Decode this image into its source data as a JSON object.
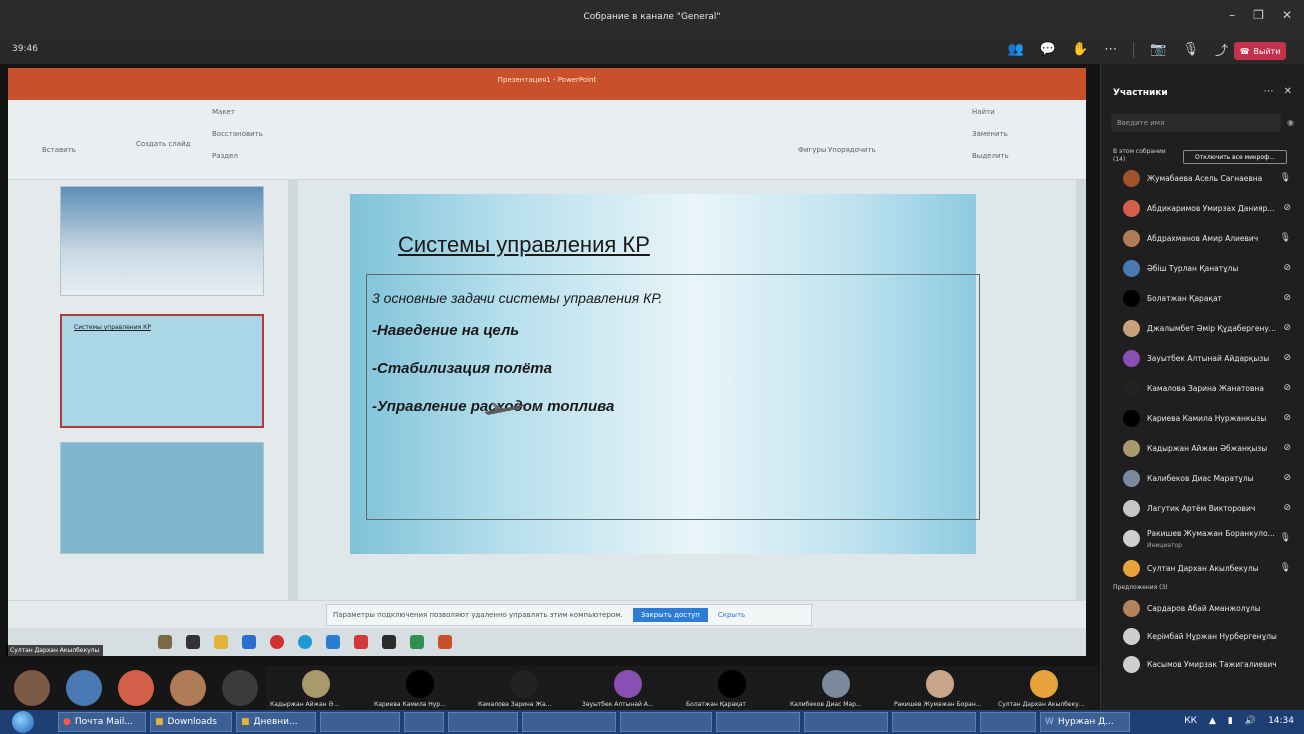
{
  "window": {
    "title": "Собрание в канале \"General\""
  },
  "meeting": {
    "timer": "39:46",
    "leave_label": "Выйти"
  },
  "shared_screen": {
    "ppt_doc_title": "Презентация1 - PowerPoint",
    "ribbon": {
      "paste": "Вставить",
      "new_slide": "Создать слайд",
      "layout": "Макет",
      "reset": "Восстановить",
      "section": "Раздел",
      "find": "Найти",
      "replace": "Заменить",
      "select": "Выделить",
      "shapes": "Фигуры",
      "arrange": "Упорядочить"
    },
    "slide": {
      "title": "Системы управления КР",
      "subtitle": "3 основные задачи системы управления КР.",
      "bullets": [
        "-Наведение на цель",
        "-Стабилизация полёта",
        "-Управление расходом топлива"
      ]
    },
    "thumb2_title": "Системы управления КР",
    "notification": {
      "text": "Параметры подключения позволяют удаленно управлять этим компьютером.",
      "button": "Закрыть доступ",
      "link": "Скрыть"
    },
    "presenter_label": "Султан Дархан Акылбекулы"
  },
  "participants_panel": {
    "title": "Участники",
    "search_placeholder": "Введите имя",
    "in_meeting_label": "В этом собрании (14)",
    "mute_all": "Отключить все микроф...",
    "participants": [
      {
        "name": "Жумабаева Асель Сагнаевна",
        "mic": "on",
        "color": "#a0522d"
      },
      {
        "name": "Абдикаримов Умирзах Данияр...",
        "mic": "off",
        "color": "#d35f4b"
      },
      {
        "name": "Абдрахманов Амир Алиевич",
        "mic": "on",
        "color": "#b07b57"
      },
      {
        "name": "Әбіш Турлан Қанатұлы",
        "mic": "off",
        "color": "#4a7ab5"
      },
      {
        "name": "Болатжан Қарақат",
        "mic": "off",
        "color": "#000000"
      },
      {
        "name": "Джалымбет Әмір Құдабергену...",
        "mic": "off",
        "color": "#c8a27a"
      },
      {
        "name": "Зауытбек Алтынай Айдарқызы",
        "mic": "off",
        "color": "#8a4fb5"
      },
      {
        "name": "Камалова Зарина Жанатовна",
        "mic": "off",
        "color": "#222222"
      },
      {
        "name": "Кариева Камила Нуржанкызы",
        "mic": "off",
        "color": "#000000"
      },
      {
        "name": "Кадыржан Айжан Әбжанқызы",
        "mic": "off",
        "color": "#a89a6c"
      },
      {
        "name": "Калибеков Диас Маратұлы",
        "mic": "off",
        "color": "#7a8a9c"
      },
      {
        "name": "Лагутик Артём Викторович",
        "mic": "off",
        "color": "#c7c7c7"
      },
      {
        "name": "Ракишев Жумажан Боранкуло...",
        "role": "Инициатор",
        "mic": "on",
        "color": "#cfcfcf"
      },
      {
        "name": "Султан Дархан Акылбекулы",
        "mic": "on",
        "color": "#e8a23a"
      }
    ],
    "suggestions_label": "Предложения (3)",
    "suggestions": [
      {
        "name": "Сардаров Абай Аманжолұлы",
        "color": "#b5835a"
      },
      {
        "name": "Керімбай Нұржан Нурбергенұлы",
        "color": "#cfcfcf"
      },
      {
        "name": "Касымов Умирзак Тажигалиевич",
        "color": "#cfcfcf"
      }
    ]
  },
  "video_strip": {
    "tiles": [
      {
        "name": "Кадыржан Айжан Ә...",
        "color": "#a89a6c"
      },
      {
        "name": "Кариева Камила Нур...",
        "color": "#000000"
      },
      {
        "name": "Камалова Зарина Жа...",
        "color": "#222222"
      },
      {
        "name": "Зауытбек Алтынай А...",
        "color": "#8a4fb5"
      },
      {
        "name": "Болатжан Қарақат",
        "color": "#000000"
      },
      {
        "name": "Калибеков Диас Мар...",
        "color": "#7a8a9c"
      },
      {
        "name": "Ракишев Жумажан Боран...",
        "color": "#c9a58b"
      },
      {
        "name": "Султан Дархан Акылбеку...",
        "color": "#e8a23a"
      }
    ]
  },
  "taskbar": {
    "mail": "Почта Mail...",
    "downloads": "Downloads",
    "journal": "Дневни...",
    "word_user": "Нуржан Д...",
    "lang": "КК",
    "time": "14:34"
  }
}
